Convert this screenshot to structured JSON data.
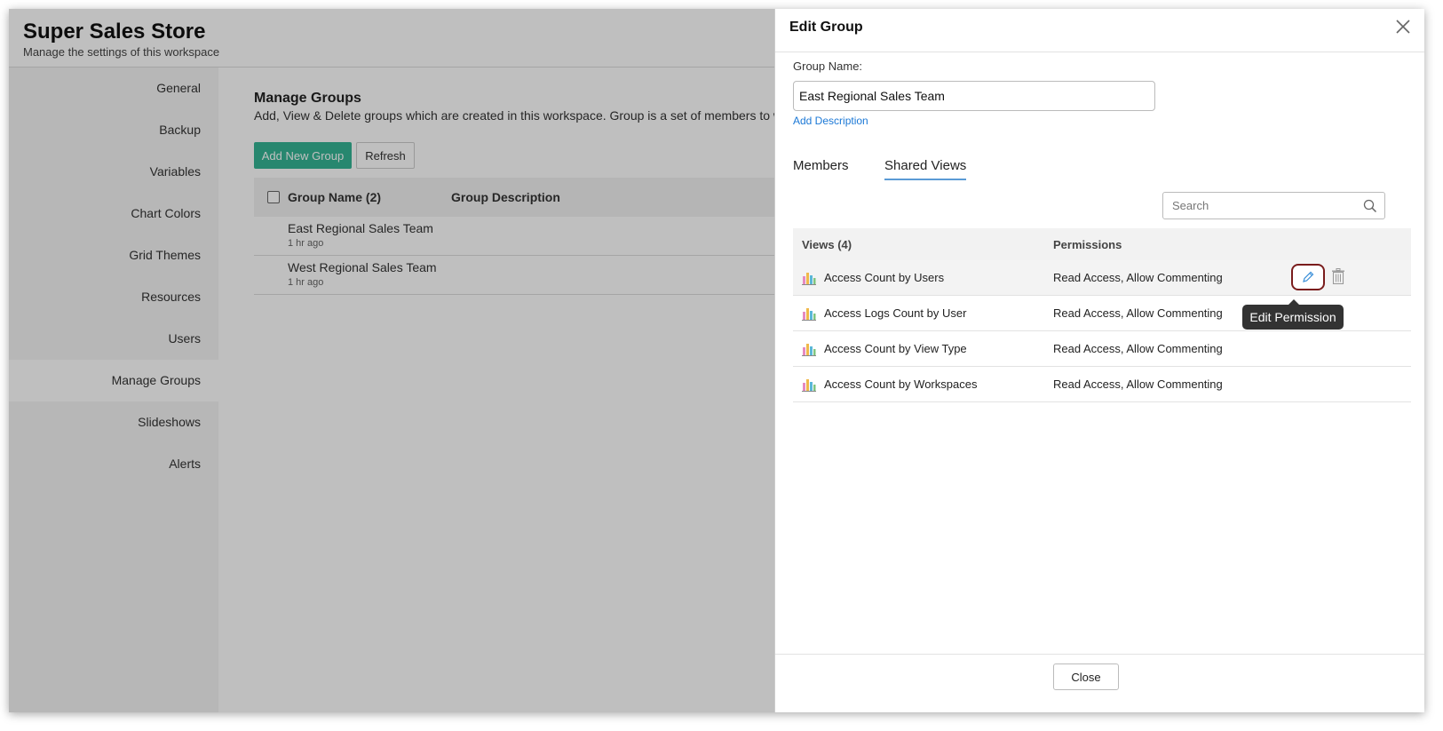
{
  "app": {
    "title": "Super Sales Store",
    "subtitle": "Manage the settings of this workspace"
  },
  "sidebar": {
    "items": [
      {
        "label": "General"
      },
      {
        "label": "Backup"
      },
      {
        "label": "Variables"
      },
      {
        "label": "Chart Colors"
      },
      {
        "label": "Grid Themes"
      },
      {
        "label": "Resources"
      },
      {
        "label": "Users"
      },
      {
        "label": "Manage Groups",
        "active": true
      },
      {
        "label": "Slideshows"
      },
      {
        "label": "Alerts"
      }
    ]
  },
  "manage_groups": {
    "title": "Manage Groups",
    "description": "Add, View & Delete groups which are created in this workspace. Group is a set of members to whom",
    "add_button": "Add New Group",
    "refresh_button": "Refresh",
    "columns": {
      "name": "Group Name (2)",
      "description": "Group Description"
    },
    "rows": [
      {
        "name": "East Regional Sales Team",
        "time": "1 hr ago"
      },
      {
        "name": "West Regional Sales Team",
        "time": "1 hr ago"
      }
    ]
  },
  "edit_group": {
    "title": "Edit Group",
    "group_name_label": "Group Name:",
    "group_name_value": "East Regional Sales Team",
    "add_description": "Add Description",
    "tabs": {
      "members": "Members",
      "shared_views": "Shared Views",
      "active": "shared_views"
    },
    "search_placeholder": "Search",
    "table": {
      "views_header": "Views (4)",
      "permissions_header": "Permissions",
      "rows": [
        {
          "view": "Access Count by Users",
          "permission": "Read Access, Allow Commenting"
        },
        {
          "view": "Access Logs Count by User",
          "permission": "Read Access, Allow Commenting"
        },
        {
          "view": "Access Count by View Type",
          "permission": "Read Access, Allow Commenting"
        },
        {
          "view": "Access Count by Workspaces",
          "permission": "Read Access, Allow Commenting"
        }
      ]
    },
    "tooltip": "Edit Permission",
    "close_button": "Close"
  },
  "colors": {
    "accent_green": "#34b594",
    "link_blue": "#1b78d6",
    "tab_underline": "#5b9bd5",
    "edit_outline": "#7a1c1c"
  },
  "icons": [
    "close-icon",
    "search-icon",
    "chart-icon",
    "pencil-icon",
    "trash-icon"
  ]
}
